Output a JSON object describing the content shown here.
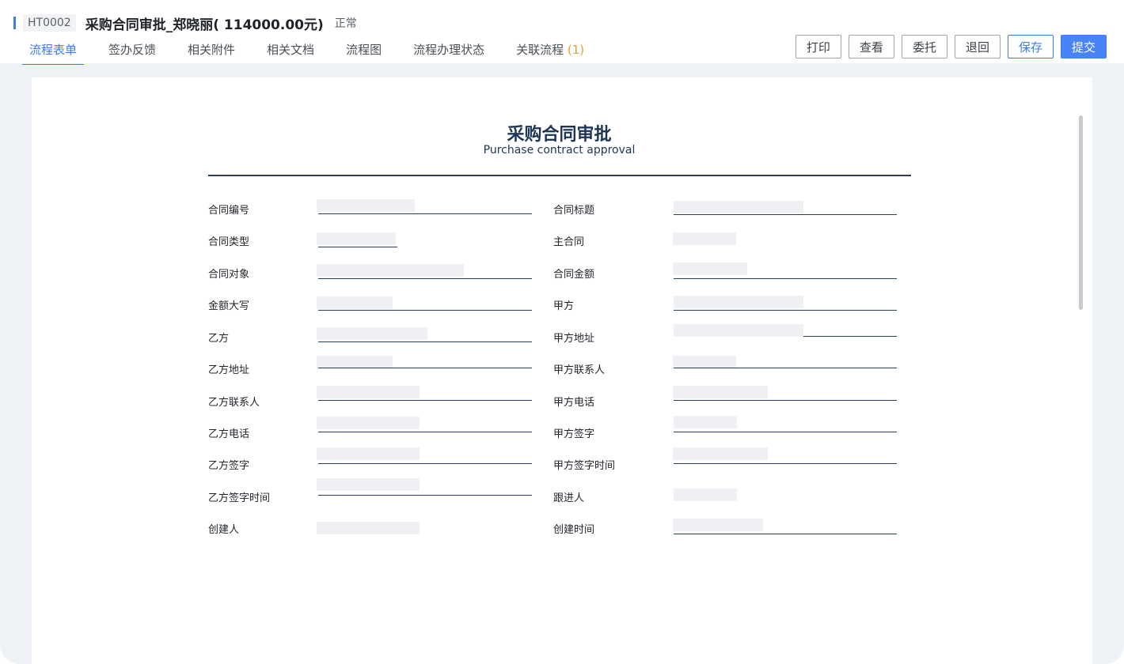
{
  "header": {
    "code": "HT0002",
    "title": "采购合同审批_郑晓丽( 114000.00元)",
    "status": "正常"
  },
  "tabs": [
    {
      "label": "流程表单"
    },
    {
      "label": "签办反馈"
    },
    {
      "label": "相关附件"
    },
    {
      "label": "相关文档"
    },
    {
      "label": "流程图"
    },
    {
      "label": "流程办理状态"
    },
    {
      "label": "关联流程",
      "count": "(1)"
    }
  ],
  "actions": {
    "print": "打印",
    "view": "查看",
    "delegate": "委托",
    "return": "退回",
    "save": "保存",
    "submit": "提交"
  },
  "form": {
    "title": "采购合同审批",
    "subtitle": "Purchase contract approval",
    "left_fields": [
      {
        "label": "合同编号"
      },
      {
        "label": "合同类型"
      },
      {
        "label": "合同对象"
      },
      {
        "label": "金额大写"
      },
      {
        "label": "乙方"
      },
      {
        "label": "乙方地址"
      },
      {
        "label": "乙方联系人"
      },
      {
        "label": "乙方电话"
      },
      {
        "label": "乙方签字"
      },
      {
        "label": "乙方签字时间"
      },
      {
        "label": "创建人"
      }
    ],
    "right_fields": [
      {
        "label": "合同标题"
      },
      {
        "label": "主合同"
      },
      {
        "label": "合同金额"
      },
      {
        "label": "甲方"
      },
      {
        "label": "甲方地址"
      },
      {
        "label": "甲方联系人"
      },
      {
        "label": "甲方电话"
      },
      {
        "label": "甲方签字"
      },
      {
        "label": "甲方签字时间"
      },
      {
        "label": "跟进人"
      },
      {
        "label": "创建时间"
      }
    ]
  },
  "colors": {
    "accent": "#3c7cf2",
    "count_badge": "#e8a12c",
    "form_title": "#1f3556",
    "page_bg": "#eff2f6"
  }
}
